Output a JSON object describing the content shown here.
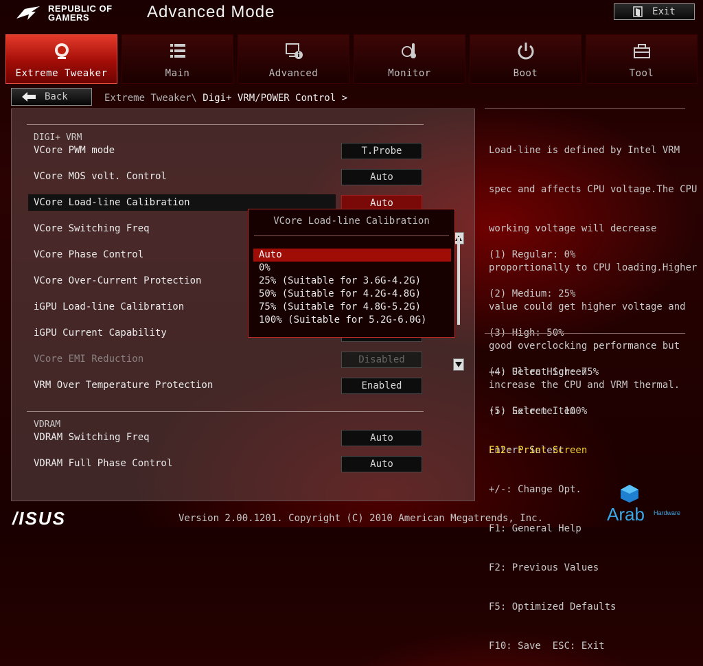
{
  "header": {
    "brand": "REPUBLIC OF GAMERS",
    "brand_line1": "REPUBLIC OF",
    "brand_line2": "GAMERS",
    "title": "Advanced Mode",
    "exit_label": "Exit"
  },
  "tabs": [
    {
      "label": "Extreme Tweaker",
      "icon": "rog-tweaker-icon",
      "active": true
    },
    {
      "label": "Main",
      "icon": "list-icon",
      "active": false
    },
    {
      "label": "Advanced",
      "icon": "info-monitor-icon",
      "active": false
    },
    {
      "label": "Monitor",
      "icon": "thermometer-icon",
      "active": false
    },
    {
      "label": "Boot",
      "icon": "power-icon",
      "active": false
    },
    {
      "label": "Tool",
      "icon": "toolbox-icon",
      "active": false
    }
  ],
  "nav": {
    "back_label": "Back",
    "breadcrumb_parent": "Extreme Tweaker\\ ",
    "breadcrumb_current": "Digi+ VRM/POWER Control >"
  },
  "main": {
    "section_digi": "DIGI+ VRM",
    "section_vdram": "VDRAM",
    "rows": [
      {
        "label": "VCore PWM mode",
        "value": "T.Probe"
      },
      {
        "label": "VCore MOS volt. Control",
        "value": "Auto"
      },
      {
        "label": "VCore Load-line Calibration",
        "value": "Auto"
      },
      {
        "label": "VCore Switching Freq",
        "value": ""
      },
      {
        "label": "VCore Phase Control",
        "value": ""
      },
      {
        "label": "VCore Over-Current Protection",
        "value": ""
      },
      {
        "label": "iGPU Load-line Calibration",
        "value": ""
      },
      {
        "label": "iGPU Current Capability",
        "value": ""
      },
      {
        "label": "VCore EMI Reduction",
        "value": "Disabled"
      },
      {
        "label": "VRM Over Temperature Protection",
        "value": "Enabled"
      },
      {
        "label": "VDRAM Switching Freq",
        "value": "Auto"
      },
      {
        "label": "VDRAM Full Phase Control",
        "value": "Auto"
      }
    ]
  },
  "popup": {
    "title": "VCore Load-line Calibration",
    "options": [
      "Auto",
      "0%",
      "25% (Suitable for 3.6G-4.2G)",
      "50% (Suitable for 4.2G-4.8G)",
      "75% (Suitable for 4.8G-5.2G)",
      "100% (Suitable for 5.2G-6.0G)"
    ],
    "selected": "Auto"
  },
  "help": {
    "description": [
      "Load-line is defined by Intel VRM",
      "spec and affects CPU voltage.The CPU",
      "working voltage will decrease",
      "proportionally to CPU loading.Higher",
      "value could get higher voltage and",
      "good overclocking performance but",
      "increase the CPU and VRM thermal."
    ],
    "levels": [
      "(1) Regular: 0%",
      "(2) Medium: 25%",
      "(3) High: 50%",
      "(4) Ultra High: 75%",
      "(5) Extreme: 100%"
    ],
    "keys": [
      "→←: Select Screen",
      "↑↓: Select Item",
      "Enter: Select",
      "+/-: Change Opt.",
      "F1: General Help",
      "F2: Previous Values",
      "F5: Optimized Defaults",
      "F10: Save  ESC: Exit"
    ],
    "print_key": "F12: Print Screen"
  },
  "footer": {
    "version": "Version 2.00.1201. Copyright (C) 2010 American Megatrends, Inc.",
    "asus_logo": "/ISUS",
    "watermark": "Arab",
    "watermark_sub": "Hardware"
  },
  "colors": {
    "accent_red": "#a00c06",
    "active_tab": "#e43b2b",
    "print_key_yellow": "#f0d030"
  }
}
